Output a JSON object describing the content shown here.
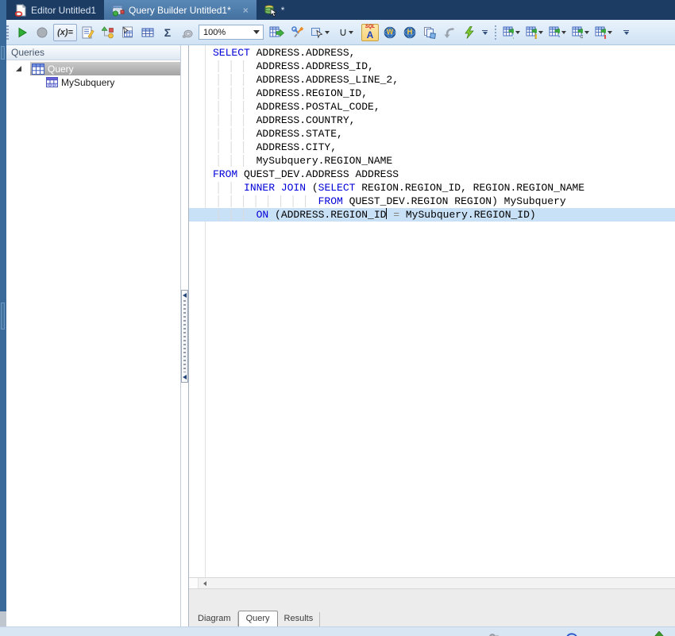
{
  "tabbar": {
    "tabs": [
      {
        "label": "Editor Untitled1",
        "icon": "editor-document-icon",
        "active": false
      },
      {
        "label": "Query Builder Untitled1*",
        "icon": "query-builder-icon",
        "active": true,
        "close_glyph": "×"
      },
      {
        "label": "*",
        "icon": "database-cursor-icon",
        "active": false
      }
    ]
  },
  "toolbar": {
    "variables_label": "(x)=",
    "totals_label": "Σ",
    "union_label": "∪",
    "zoom_value": "100%",
    "syntax_badge": {
      "top": "SQL",
      "letter": "A"
    },
    "web_letters": {
      "w": "W",
      "h": "H"
    },
    "icons": [
      "grip",
      "run-icon",
      "stop-icon",
      "variables-icon",
      "edit-query-icon",
      "query-diagram-icon",
      "query-table-icon",
      "criteria-grid-icon",
      "totals-icon",
      "tipped-lens-icon",
      "zoom-combobox",
      "send-to-editor-icon",
      "tools-icon",
      "select-mode-icon",
      "union-icon",
      "syntax-check-icon",
      "web-w-icon",
      "web-h-icon",
      "copy-icon",
      "paste-icon",
      "optimize-icon",
      "overflow-chevron",
      "export-excel-icon",
      "export-run-icon",
      "export-append-icon",
      "export-link-icon",
      "export-chart-icon",
      "overflow-chevron"
    ]
  },
  "sidebar": {
    "title": "Queries",
    "tree": [
      {
        "label": "Query",
        "icon": "query-grid-icon",
        "expanded": true,
        "selected": true,
        "level": 0
      },
      {
        "label": "MySubquery",
        "icon": "subquery-table-icon",
        "selected": false,
        "level": 1
      }
    ]
  },
  "editor": {
    "language": "sql",
    "current_line_color": "#c9e1f6",
    "keyword_color": "#0000d8",
    "lines": [
      {
        "indent": 0,
        "segments": [
          {
            "text": "SELECT",
            "type": "keyword"
          },
          {
            "text": " ADDRESS.ADDRESS,",
            "type": "plain"
          }
        ]
      },
      {
        "indent": 7,
        "segments": [
          {
            "text": "ADDRESS.ADDRESS_ID,",
            "type": "plain"
          }
        ]
      },
      {
        "indent": 7,
        "segments": [
          {
            "text": "ADDRESS.ADDRESS_LINE_2,",
            "type": "plain"
          }
        ]
      },
      {
        "indent": 7,
        "segments": [
          {
            "text": "ADDRESS.REGION_ID,",
            "type": "plain"
          }
        ]
      },
      {
        "indent": 7,
        "segments": [
          {
            "text": "ADDRESS.POSTAL_CODE,",
            "type": "plain"
          }
        ]
      },
      {
        "indent": 7,
        "segments": [
          {
            "text": "ADDRESS.COUNTRY,",
            "type": "plain"
          }
        ]
      },
      {
        "indent": 7,
        "segments": [
          {
            "text": "ADDRESS.STATE,",
            "type": "plain"
          }
        ]
      },
      {
        "indent": 7,
        "segments": [
          {
            "text": "ADDRESS.CITY,",
            "type": "plain"
          }
        ]
      },
      {
        "indent": 7,
        "segments": [
          {
            "text": "MySubquery.REGION_NAME",
            "type": "plain"
          }
        ]
      },
      {
        "indent": 0,
        "segments": [
          {
            "text": "FROM",
            "type": "keyword"
          },
          {
            "text": " QUEST_DEV.ADDRESS ADDRESS",
            "type": "plain"
          }
        ]
      },
      {
        "indent": 5,
        "segments": [
          {
            "text": "INNER JOIN",
            "type": "keyword"
          },
          {
            "text": " (",
            "type": "plain"
          },
          {
            "text": "SELECT",
            "type": "keyword"
          },
          {
            "text": " REGION.REGION_ID, REGION.REGION_NAME",
            "type": "plain"
          }
        ]
      },
      {
        "indent": 17,
        "segments": [
          {
            "text": "FROM",
            "type": "keyword"
          },
          {
            "text": " QUEST_DEV.REGION REGION) MySubquery",
            "type": "plain"
          }
        ]
      },
      {
        "indent": 7,
        "highlight": true,
        "segments": [
          {
            "text": "ON",
            "type": "keyword"
          },
          {
            "text": " (ADDRESS.REGION_ID",
            "type": "plain"
          },
          {
            "text": "",
            "type": "caret"
          },
          {
            "text": " ",
            "type": "plain"
          },
          {
            "text": "=",
            "type": "op"
          },
          {
            "text": " MySubquery.REGION_ID)",
            "type": "plain"
          }
        ]
      }
    ]
  },
  "bottom_tabs": {
    "tabs": [
      {
        "label": "Diagram",
        "active": false
      },
      {
        "label": "Query",
        "active": true
      },
      {
        "label": "Results",
        "active": false
      }
    ]
  },
  "colors": {
    "titlebar": "#1c3c63",
    "active_tab": "#4e7dab",
    "toolbar_top": "#eaf3fc",
    "toolbar_bottom": "#cfe2f4",
    "left_strip": "#3a6a9a",
    "selection_gray": "#b4b4b4",
    "bottom_strip": "#d8e6f4"
  }
}
